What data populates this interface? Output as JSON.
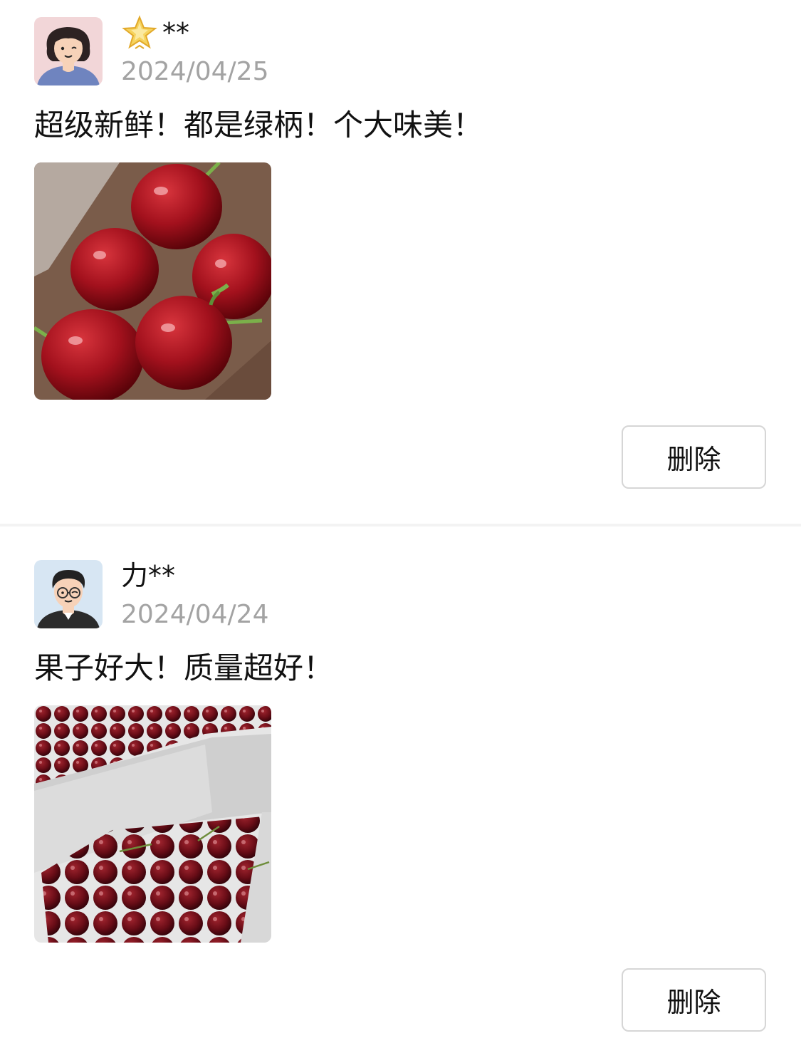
{
  "reviews": [
    {
      "username": "**",
      "date": "2024/04/25",
      "comment": "超级新鲜！都是绿柄！个大味美！",
      "badge_icon": "star-icon",
      "avatar_icon": "female-avatar-icon",
      "photo": "cherries-closeup-photo",
      "delete_label": "删除"
    },
    {
      "username": "力**",
      "date": "2024/04/24",
      "comment": "果子好大！质量超好！",
      "avatar_icon": "male-avatar-icon",
      "photo": "cherries-box-photo",
      "delete_label": "删除"
    }
  ],
  "colors": {
    "date_gray": "#a3a3a3",
    "button_border": "#d6d6d6",
    "divider": "#f3f3f3",
    "avatar1_bg": "#f2d6d8",
    "avatar2_bg": "#d7e6f3"
  }
}
